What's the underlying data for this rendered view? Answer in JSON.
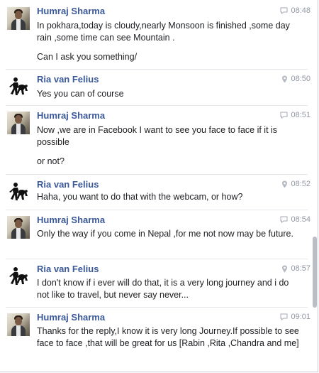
{
  "messages": [
    {
      "sender": "Humraj Sharma",
      "avatar": "photo",
      "time": "08:48",
      "status_icon": "message-bubble-icon",
      "paragraphs": [
        "In pokhara,today is cloudy,nearly Monsoon is finished ,some day rain ,some time can see Mountain .",
        "Can I ask you something/"
      ]
    },
    {
      "sender": "Ria van Felius",
      "avatar": "silhouette",
      "time": "08:50",
      "status_icon": "location-pin-icon",
      "paragraphs": [
        "Yes you can of course"
      ]
    },
    {
      "sender": "Humraj Sharma",
      "avatar": "photo",
      "time": "08:51",
      "status_icon": "message-bubble-icon",
      "paragraphs": [
        "Now ,we are in Facebook  I want to see you  face to face if it is possible",
        "or not?"
      ]
    },
    {
      "sender": "Ria van Felius",
      "avatar": "silhouette",
      "time": "08:52",
      "status_icon": "location-pin-icon",
      "paragraphs": [
        "Haha, you want to do that with the webcam, or how?"
      ]
    },
    {
      "sender": "Humraj Sharma",
      "avatar": "photo",
      "time": "08:54",
      "status_icon": "message-bubble-icon",
      "paragraphs": [
        "Only the way if you come in Nepal ,for me not now may be future."
      ]
    },
    {
      "sender": "Ria van Felius",
      "avatar": "silhouette",
      "time": "08:57",
      "status_icon": "location-pin-icon",
      "paragraphs": [
        "I don't know if i ever will do that, it is a very long journey and i do not like to travel, but never say never..."
      ]
    },
    {
      "sender": "Humraj Sharma",
      "avatar": "photo",
      "time": "09:01",
      "status_icon": "message-bubble-icon",
      "paragraphs": [
        "Thanks for the reply,I know it is very long Journey.If possible to see face to face  ,that  will be great for us [Rabin ,Rita ,Chandra and me]"
      ]
    }
  ],
  "colors": {
    "sender_name": "#3b5998",
    "timestamp": "#9197a3",
    "message_text": "#1c1e21",
    "scrollbar_thumb": "#b9bec7"
  }
}
